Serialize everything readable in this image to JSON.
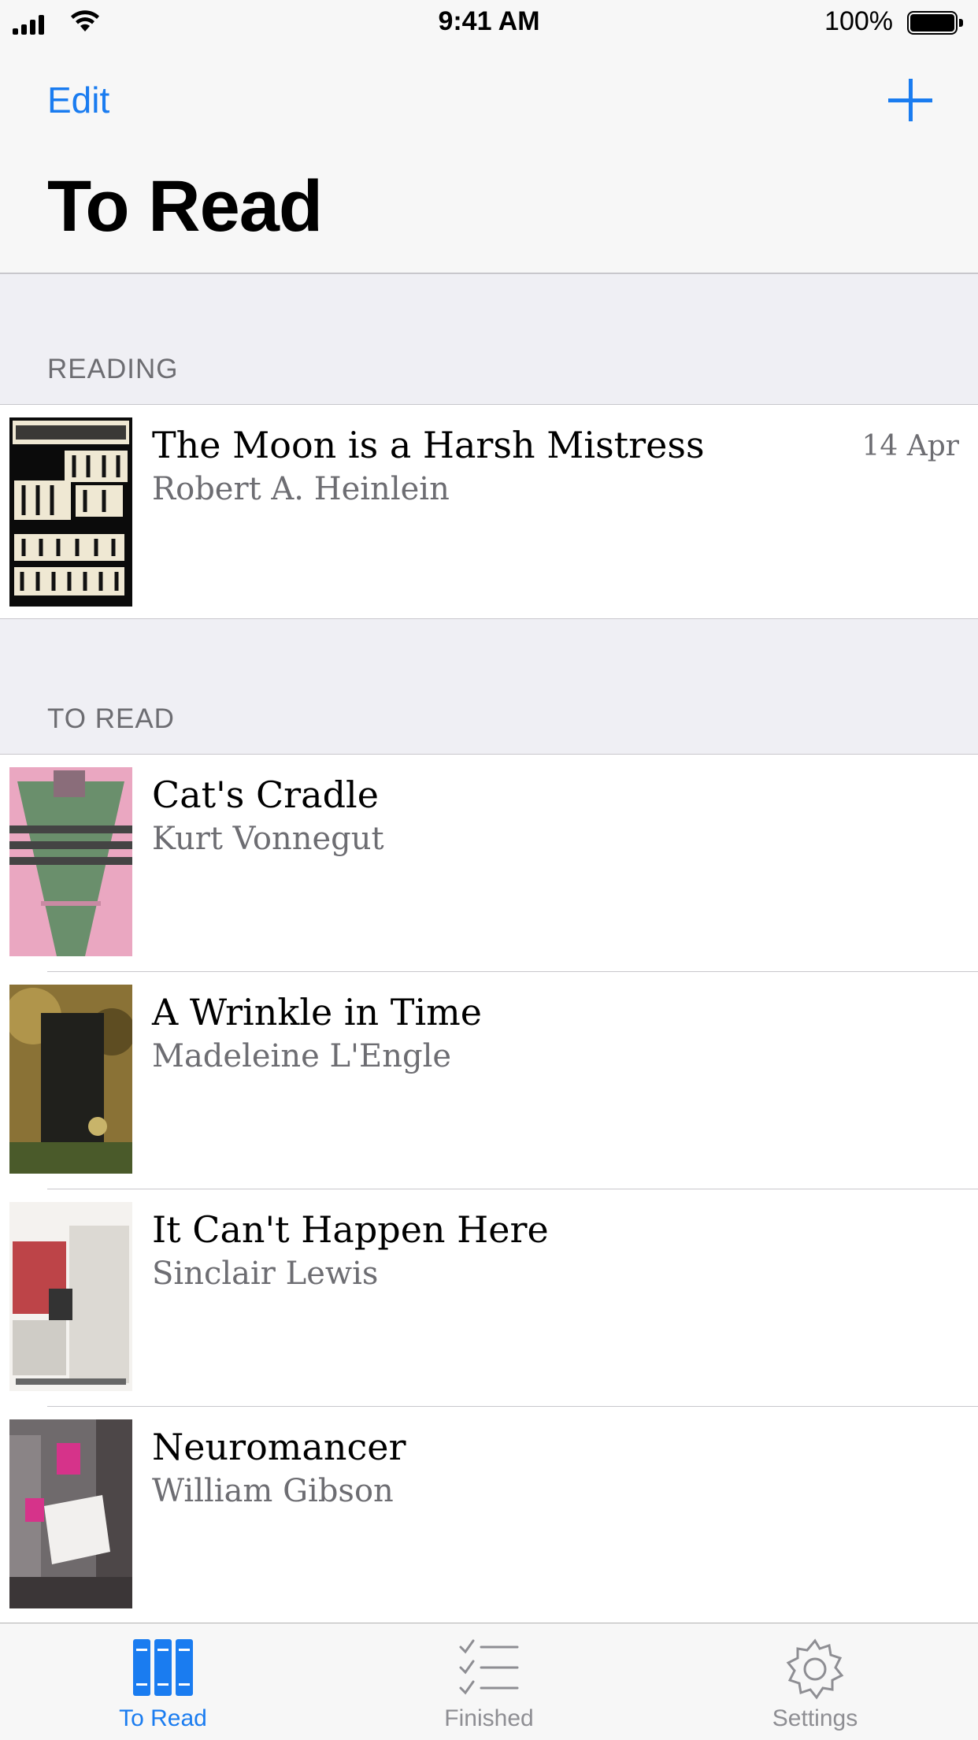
{
  "status_bar": {
    "time": "9:41 AM",
    "battery": "100%"
  },
  "nav": {
    "edit_label": "Edit",
    "title": "To Read",
    "add_icon": "plus-icon"
  },
  "sections": [
    {
      "header": "READING",
      "rows": [
        {
          "title": "The Moon is a Harsh Mistress",
          "author": "Robert A. Heinlein",
          "date": "14 Apr"
        }
      ]
    },
    {
      "header": "TO READ",
      "rows": [
        {
          "title": "Cat's Cradle",
          "author": "Kurt Vonnegut"
        },
        {
          "title": "A Wrinkle in Time",
          "author": "Madeleine L'Engle"
        },
        {
          "title": "It Can't Happen Here",
          "author": "Sinclair Lewis"
        },
        {
          "title": "Neuromancer",
          "author": "William Gibson"
        }
      ]
    }
  ],
  "tabs": [
    {
      "label": "To Read",
      "icon": "books-icon",
      "active": true
    },
    {
      "label": "Finished",
      "icon": "checklist-icon",
      "active": false
    },
    {
      "label": "Settings",
      "icon": "gear-icon",
      "active": false
    }
  ],
  "colors": {
    "accent": "#1a7cf0",
    "secondary_text": "#6d6d72",
    "background": "#efeff4"
  }
}
